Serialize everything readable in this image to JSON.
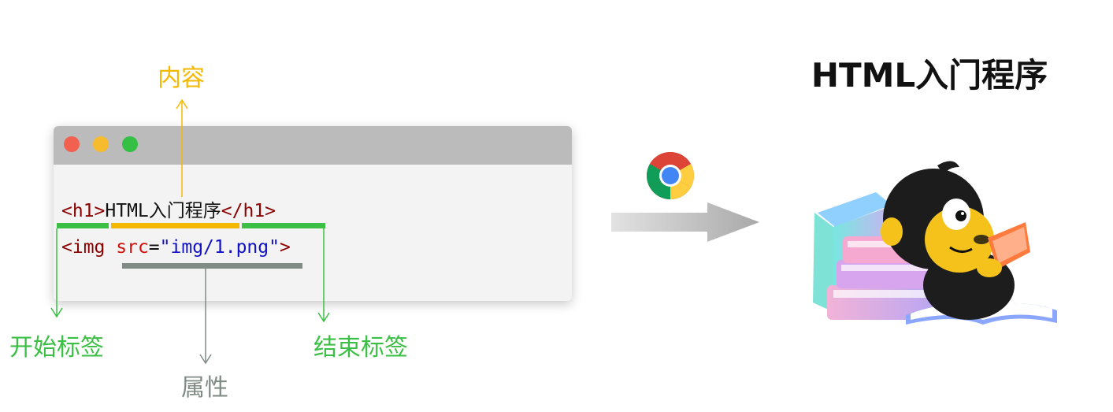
{
  "diagram": {
    "code_line1": {
      "open_tag": "<h1>",
      "content": "HTML入门程序",
      "close_tag": "</h1>"
    },
    "code_line2": {
      "tag_start": "<img ",
      "attr_name": "src",
      "equals": "=",
      "attr_value": "\"img/1.png\"",
      "tag_end": ">"
    },
    "annotations": {
      "content": "内容",
      "start_tag": "开始标签",
      "end_tag": "结束标签",
      "attribute": "属性"
    },
    "result_title": "HTML入门程序",
    "colors": {
      "content": "#f5b800",
      "tags": "#3bbf45",
      "attribute": "#808b86"
    },
    "icons": {
      "browser": "chrome-icon",
      "flow": "right-arrow",
      "mascot": "monkey-reading-books-illustration"
    }
  }
}
